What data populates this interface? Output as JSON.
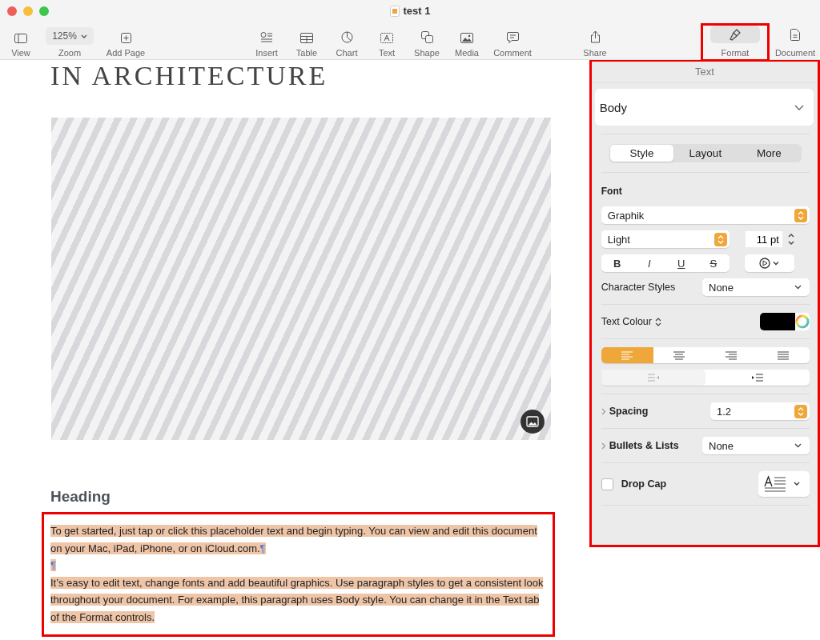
{
  "window": {
    "title": "test 1"
  },
  "toolbar": {
    "view": "View",
    "zoom_value": "125%",
    "zoom": "Zoom",
    "add_page": "Add Page",
    "insert": "Insert",
    "table": "Table",
    "chart": "Chart",
    "text": "Text",
    "shape": "Shape",
    "media": "Media",
    "comment": "Comment",
    "share": "Share",
    "format": {
      "label": "Format",
      "selected": true
    },
    "document": {
      "label": "Document",
      "selected": false
    }
  },
  "document": {
    "title": "IN ARCHITECTURE",
    "heading": "Heading",
    "paragraphs": [
      {
        "text": "To get started, just tap or click this placeholder text and begin typing. You can view and edit this document on your Mac, iPad, iPhone, or on iCloud.com.",
        "mark": "¶",
        "selected": true
      },
      {
        "mark": "¶",
        "selected": true
      },
      {
        "text": "It’s easy to edit text, change fonts and add beautiful graphics. Use paragraph styles to get a consistent look throughout your document. For example, this paragraph uses Body style. You can change it in the Text tab of the Format controls.",
        "selected": true
      }
    ]
  },
  "sidebar": {
    "header": "Text",
    "paragraph_style": "Body",
    "tabs": [
      {
        "label": "Style",
        "selected": true
      },
      {
        "label": "Layout",
        "selected": false
      },
      {
        "label": "More",
        "selected": false
      }
    ],
    "font_label": "Font",
    "font": "Graphik",
    "typeface": "Light",
    "size": "11 pt",
    "style_buttons": [
      {
        "label": "B",
        "kind": "bold"
      },
      {
        "label": "I",
        "kind": "italic"
      },
      {
        "label": "U",
        "kind": "underline"
      },
      {
        "label": "S",
        "kind": "strike"
      }
    ],
    "character_styles_label": "Character Styles",
    "character_style": "None",
    "text_colour_label": "Text Colour",
    "alignments": [
      {
        "selected": true
      },
      {
        "selected": false
      },
      {
        "selected": false
      },
      {
        "selected": false
      }
    ],
    "indents": [
      {
        "disabled": true
      },
      {
        "disabled": false
      }
    ],
    "spacing_label": "Spacing",
    "spacing": "1.2",
    "bullets_label": "Bullets & Lists",
    "bullets": "None",
    "drop_cap": {
      "label": "Drop Cap",
      "checked": false
    }
  }
}
